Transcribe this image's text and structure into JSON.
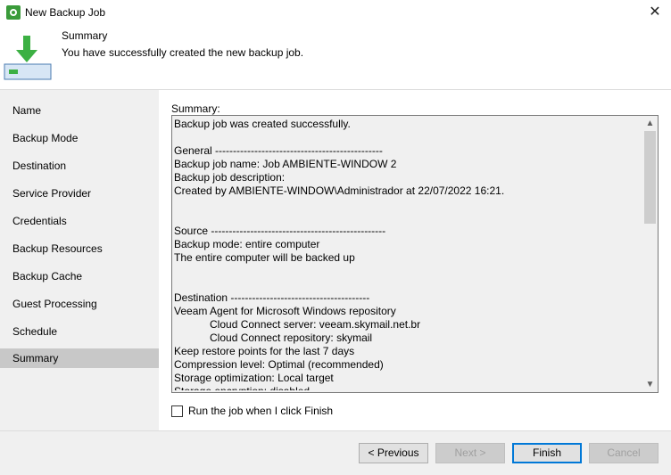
{
  "window": {
    "title": "New Backup Job",
    "close_glyph": "✕"
  },
  "header": {
    "title": "Summary",
    "subtitle": "You have successfully created the new backup job.",
    "icon": "download-arrow-icon"
  },
  "sidebar": {
    "items": [
      {
        "label": "Name"
      },
      {
        "label": "Backup Mode"
      },
      {
        "label": "Destination"
      },
      {
        "label": "Service Provider"
      },
      {
        "label": "Credentials"
      },
      {
        "label": "Backup Resources"
      },
      {
        "label": "Backup Cache"
      },
      {
        "label": "Guest Processing"
      },
      {
        "label": "Schedule"
      },
      {
        "label": "Summary",
        "active": true
      }
    ]
  },
  "main": {
    "summary_label": "Summary:",
    "summary_text": "Backup job was created successfully.\n\nGeneral -----------------------------------------------\nBackup job name: Job AMBIENTE-WINDOW 2\nBackup job description:\nCreated by AMBIENTE-WINDOW\\Administrador at 22/07/2022 16:21.\n\n\nSource -------------------------------------------------\nBackup mode: entire computer\nThe entire computer will be backed up\n\n\nDestination ---------------------------------------\nVeeam Agent for Microsoft Windows repository\n            Cloud Connect server: veeam.skymail.net.br\n            Cloud Connect repository: skymail\nKeep restore points for the last 7 days\nCompression level: Optimal (recommended)\nStorage optimization: Local target\nStorage encryption: disabled",
    "scroll_up_glyph": "▲",
    "scroll_down_glyph": "▼",
    "run_checkbox_label": "Run the job when I click Finish",
    "run_checkbox_checked": false
  },
  "footer": {
    "previous": "< Previous",
    "next": "Next >",
    "finish": "Finish",
    "cancel": "Cancel"
  },
  "colors": {
    "sidebar_bg": "#f0f0f0",
    "active_item_bg": "#c8c8c8",
    "accent": "#0078d7",
    "icon_green": "#3a9b3a"
  }
}
